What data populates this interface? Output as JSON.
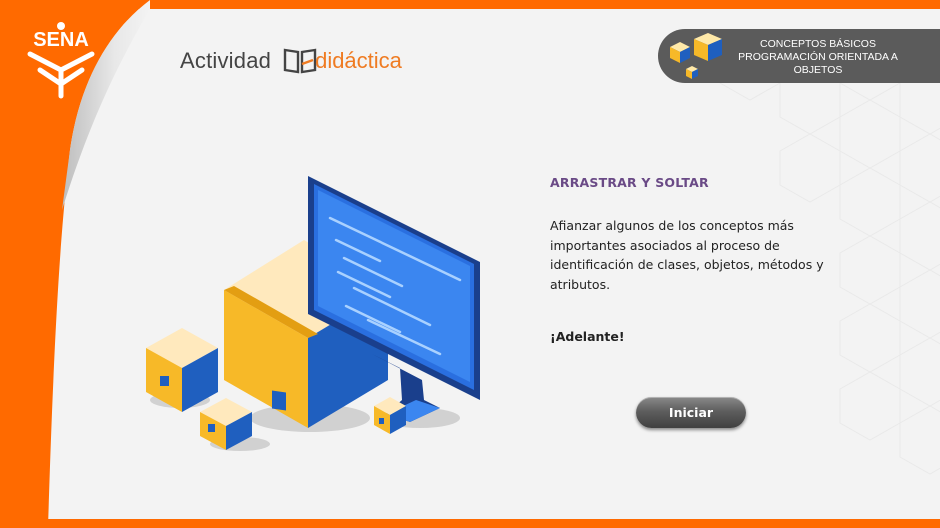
{
  "header": {
    "logo_text": "SENA",
    "brand_prefix": "Actividad",
    "brand_suffix": "didáctica"
  },
  "badge": {
    "lines": [
      "CONCEPTOS BÁSICOS",
      "PROGRAMACIÓN ORIENTADA A",
      "OBJETOS"
    ]
  },
  "content": {
    "title": "ARRASTRAR Y SOLTAR",
    "description": "Afianzar algunos de los conceptos más importantes asociados al proceso de identificación de clases, objetos, métodos y atributos.",
    "cta": "¡Adelante!"
  },
  "start_button": {
    "label": "Iniciar"
  },
  "colors": {
    "frame": "#ff6a00",
    "page": "#f3f3f3",
    "title": "#6a4a86",
    "badge": "#5b5b5b",
    "brand_accent": "#ef7b22",
    "box_yellow": "#f7b928",
    "box_blue": "#1f5fbf"
  },
  "icons": {
    "logo": "sena-logo-icon",
    "brand": "book-icon",
    "badge": "boxes-icon",
    "illustration": "computer-boxes-illustration"
  }
}
